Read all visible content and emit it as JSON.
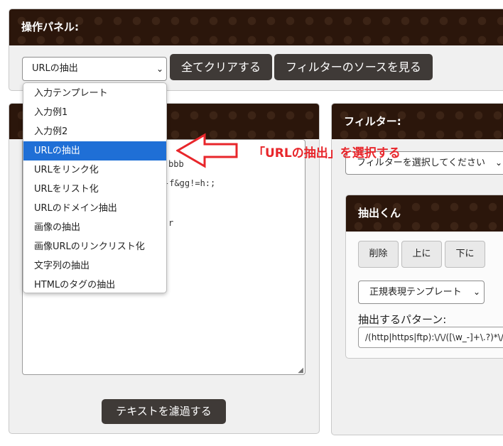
{
  "operation_panel": {
    "title": "操作パネル:",
    "extract_select": {
      "value": "URLの抽出"
    },
    "clear_all_label": "全てクリアする",
    "view_source_label": "フィルターのソースを見る"
  },
  "dropdown": {
    "options": [
      "入力テンプレート",
      "入力例1",
      "入力例2",
      "URLの抽出",
      "URLをリンク化",
      "URLをリスト化",
      "URLのドメイン抽出",
      "画像の抽出",
      "画像URLのリンクリスト化",
      "文字列の抽出",
      "HTMLのタグの抽出"
    ],
    "selected_index": 3
  },
  "annotation": {
    "text": "「URLの抽出」を選択する",
    "color": "#e8262b"
  },
  "input_panel": {
    "visible_text": [
      "bbb",
      "-f&gg!=h:;",
      "r"
    ],
    "filter_button_label": "テキストを濾過する"
  },
  "filter_panel": {
    "title": "フィルター:",
    "select_placeholder": "フィルターを選択してください"
  },
  "extractor": {
    "title": "抽出くん",
    "delete_label": "削除",
    "up_label": "上に",
    "down_label": "下に",
    "template_select": "正規表現テンプレート",
    "pattern_label": "抽出するパターン:",
    "pattern_value": "/(http|https|ftp):\\/\\/([\\w_-]+\\.?)*\\/?("
  },
  "colors": {
    "header_bg": "#2b160b",
    "button_bg": "#3f3a37",
    "selected_bg": "#1f6fd6",
    "panel_bg": "#f0f0f0"
  },
  "icons": {
    "select_arrow": "chevron-down-icon",
    "pointer_arrow": "left-arrow-icon"
  }
}
